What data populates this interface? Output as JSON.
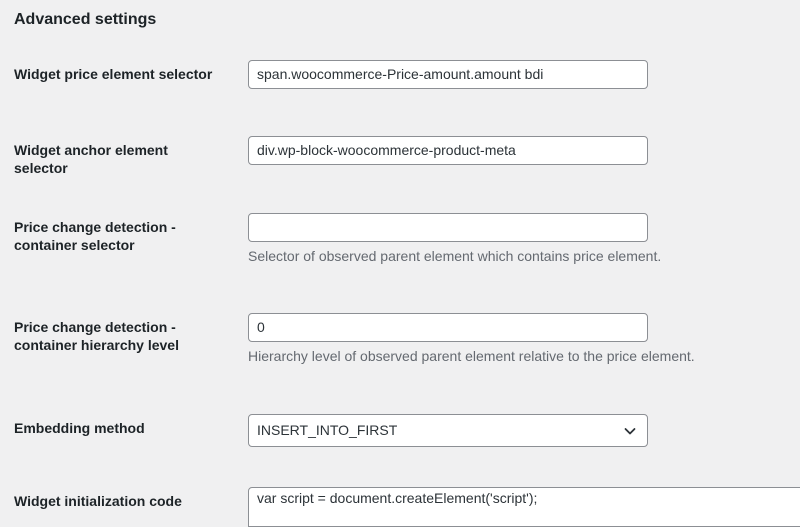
{
  "section": {
    "title": "Advanced settings"
  },
  "fields": {
    "price_selector": {
      "label": "Widget price element selector",
      "value": "span.woocommerce-Price-amount.amount bdi"
    },
    "anchor_selector": {
      "label": "Widget anchor element selector",
      "value": "div.wp-block-woocommerce-product-meta"
    },
    "container_selector": {
      "label": "Price change detection - container selector",
      "value": "",
      "description": "Selector of observed parent element which contains price element."
    },
    "hierarchy_level": {
      "label": "Price change detection - container hierarchy level",
      "value": "0",
      "description": "Hierarchy level of observed parent element relative to the price element."
    },
    "embedding_method": {
      "label": "Embedding method",
      "selected": "INSERT_INTO_FIRST"
    },
    "init_code": {
      "label": "Widget initialization code",
      "value": "var script = document.createElement('script');"
    }
  },
  "icons": {
    "select_chevron": "chevron-down-icon"
  },
  "colors": {
    "background": "#f0f0f1",
    "text": "#1d2327",
    "description": "#646970",
    "border": "#8c8f94"
  }
}
